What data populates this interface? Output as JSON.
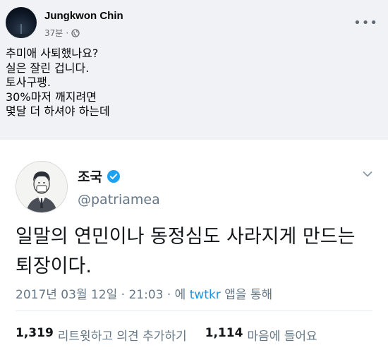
{
  "post": {
    "author": "Jungkwon Chin",
    "time": "37분",
    "meta_sep": "·",
    "more": "•••",
    "lines": [
      "추미애 사퇴했나요?",
      "실은 잘린 겁니다.",
      "토사구팽.",
      "30%마저 깨지려면",
      "몇달 더 하셔야 하는데"
    ]
  },
  "tweet": {
    "name": "조국",
    "handle": "@patriamea",
    "text_lines": [
      "일말의 연민이나 동정심도 사라지게 만드는",
      "퇴장이다."
    ],
    "date_prefix": "2017년 03월 12일 · 21:03 · 에 ",
    "source": "twtkr",
    "date_suffix": " 앱을 통해",
    "retweets_count": "1,319",
    "retweets_label": "리트윗하고 의견 추가하기",
    "likes_count": "1,114",
    "likes_label": "마음에 들어요",
    "accent_color": "#1da1f2"
  }
}
